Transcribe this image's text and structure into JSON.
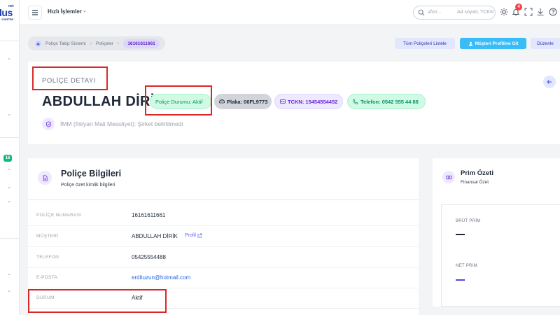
{
  "logo": {
    "sup": "net",
    "main": "lus",
    "sub": "YÖNETİMİ"
  },
  "sidebar": {
    "badge": "16"
  },
  "header": {
    "quick_actions": "Hızlı İşlemler",
    "search_placeholder_left": "əfon...",
    "search_placeholder_right": "Ad soyad, TCKN",
    "notification_count": "4"
  },
  "breadcrumb": {
    "items": [
      "Poliçe Takip Sistemi",
      "Poliçeler"
    ],
    "current": "16161611661"
  },
  "actions": {
    "list_all": "Tüm Poliçeleri Listele",
    "go_profile": "Müşteri Profiline Git",
    "edit": "Düzenle"
  },
  "detail": {
    "section_label": "POLİÇE DETAYI",
    "customer_name": "ABDULLAH DİRİK",
    "status_pill": "Poliçe Durumu: Aktif",
    "plate_pill": "Plaka: 06FL9773",
    "tckn_pill": "TCKN: 15454554452",
    "phone_pill": "Telefon: 0542 555 44 88",
    "imm_text": "İMM (İhtiyari Mali Mesuliyet): Şirket belirtilmedi"
  },
  "policy_info": {
    "title": "Poliçe Bilgileri",
    "subtitle": "Poliçe özet kimlik bilgileri",
    "rows": [
      {
        "key": "POLİÇE NUMARASI",
        "value": "16161611661"
      },
      {
        "key": "MÜŞTERİ",
        "value": "ABDULLAH DİRİK",
        "link": "Profil"
      },
      {
        "key": "TELEFON",
        "value": "05425554488"
      },
      {
        "key": "E-POSTA",
        "value": "erdituzun@hotmail.com"
      },
      {
        "key": "DURUM",
        "value": "Aktif"
      }
    ]
  },
  "premium": {
    "title": "Prim Özeti",
    "subtitle": "Finansal Özet",
    "gross_label": "BRÜT PRİM",
    "net_label": "NET PRİM"
  },
  "colors": {
    "accent": "#38bdf8",
    "success": "#059669",
    "purple": "#6d28d9",
    "annotation": "#dc2626"
  }
}
